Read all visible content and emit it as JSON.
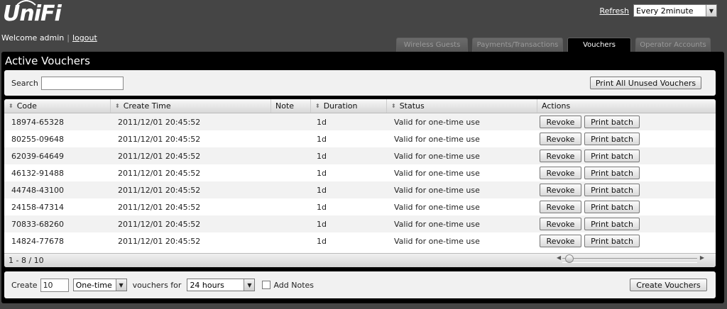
{
  "app": {
    "logo_text": "UniFi"
  },
  "header": {
    "welcome_text": "Welcome admin",
    "logout_label": "logout",
    "refresh_label": "Refresh",
    "refresh_interval": "Every 2minute"
  },
  "tabs": [
    {
      "label": "Wireless Guests",
      "active": false
    },
    {
      "label": "Payments/Transactions",
      "active": false
    },
    {
      "label": "Vouchers",
      "active": true
    },
    {
      "label": "Operator Accounts",
      "active": false
    }
  ],
  "panel": {
    "title": "Active Vouchers",
    "search_label": "Search",
    "search_value": "",
    "print_all_label": "Print All Unused Vouchers"
  },
  "table": {
    "columns": [
      "Code",
      "Create Time",
      "Note",
      "Duration",
      "Status",
      "Actions"
    ],
    "rows": [
      {
        "code": "18974-65328",
        "time": "2011/12/01  20:45:52",
        "note": "",
        "duration": "1d",
        "status": "Valid for one-time use"
      },
      {
        "code": "80255-09648",
        "time": "2011/12/01  20:45:52",
        "note": "",
        "duration": "1d",
        "status": "Valid for one-time use"
      },
      {
        "code": "62039-64649",
        "time": "2011/12/01  20:45:52",
        "note": "",
        "duration": "1d",
        "status": "Valid for one-time use"
      },
      {
        "code": "46132-91488",
        "time": "2011/12/01  20:45:52",
        "note": "",
        "duration": "1d",
        "status": "Valid for one-time use"
      },
      {
        "code": "44748-43100",
        "time": "2011/12/01  20:45:52",
        "note": "",
        "duration": "1d",
        "status": "Valid for one-time use"
      },
      {
        "code": "24158-47314",
        "time": "2011/12/01  20:45:52",
        "note": "",
        "duration": "1d",
        "status": "Valid for one-time use"
      },
      {
        "code": "70833-68260",
        "time": "2011/12/01  20:45:52",
        "note": "",
        "duration": "1d",
        "status": "Valid for one-time use"
      },
      {
        "code": "14824-77678",
        "time": "2011/12/01  20:45:52",
        "note": "",
        "duration": "1d",
        "status": "Valid for one-time use"
      }
    ],
    "revoke_label": "Revoke",
    "print_batch_label": "Print batch",
    "pagination": "1 - 8 / 10"
  },
  "create": {
    "label": "Create",
    "count": "10",
    "type": "One-time",
    "vouchers_for_label": "vouchers for",
    "duration": "24 hours",
    "add_notes_label": "Add Notes",
    "add_notes_checked": false,
    "button_label": "Create Vouchers"
  },
  "icons": {
    "dropdown": "chevron-down-icon",
    "sort": "sort-icon",
    "slider_left": "arrow-left-icon",
    "slider_right": "arrow-right-icon"
  }
}
